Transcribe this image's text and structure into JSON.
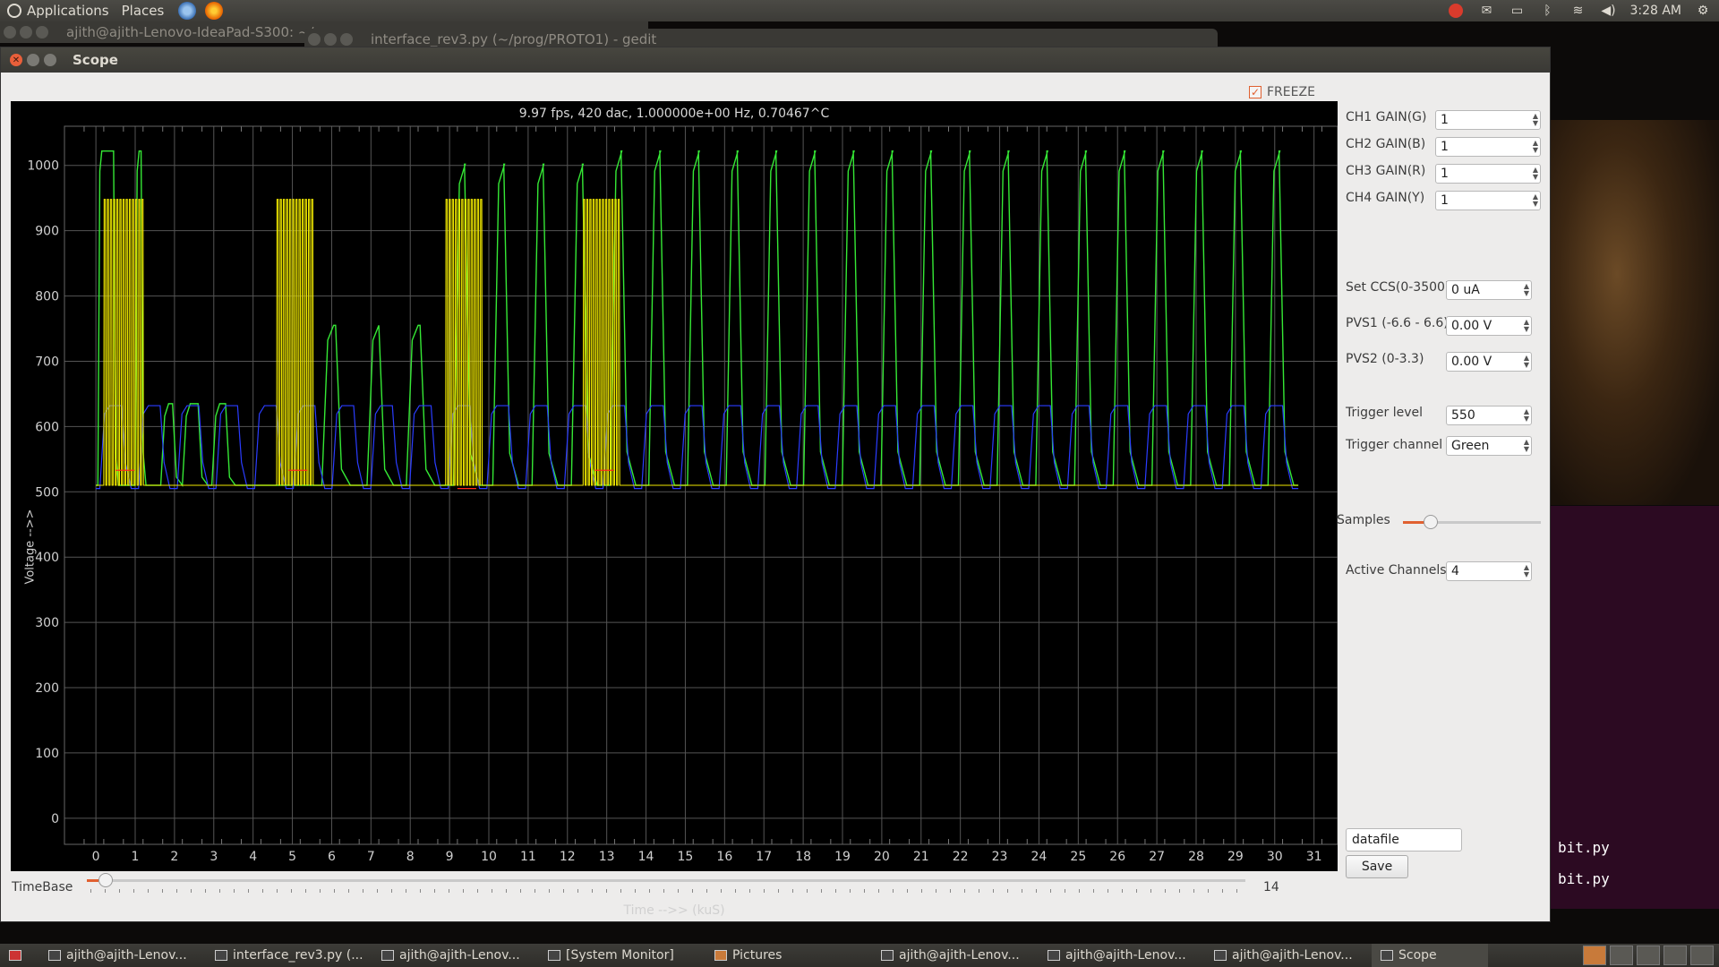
{
  "topbar": {
    "menus": [
      "Applications",
      "Places"
    ],
    "clock": "3:28 AM"
  },
  "background_windows": {
    "terminal_title": "ajith@ajith-Lenovo-IdeaPad-S300: ~/",
    "gedit_title": "interface_rev3.py (~/prog/PROTO1) - gedit",
    "terminal_lines": [
      "bit.py",
      "bit.py"
    ]
  },
  "window": {
    "title": "Scope",
    "freeze_label": "FREEZE",
    "freeze_checked": true
  },
  "plot": {
    "header": "9.97 fps, 420 dac, 1.000000e+00 Hz, 0.70467^C",
    "ylabel": "Voltage -->>",
    "xlabel": "Time -->> (kuS)",
    "yticks": [
      "1000",
      "900",
      "800",
      "700",
      "600",
      "500",
      "400",
      "300",
      "200",
      "100",
      "0"
    ],
    "xticks": [
      "0",
      "1",
      "2",
      "3",
      "4",
      "5",
      "6",
      "7",
      "8",
      "9",
      "10",
      "11",
      "12",
      "13",
      "14",
      "15",
      "16",
      "17",
      "18",
      "19",
      "20",
      "21",
      "22",
      "23",
      "24",
      "25",
      "26",
      "27",
      "28",
      "29",
      "30",
      "31"
    ]
  },
  "chart_data": {
    "type": "line",
    "title": "9.97 fps, 420 dac, 1.000000e+00 Hz, 0.70467^C",
    "xlabel": "Time -->> (kuS)",
    "ylabel": "Voltage -->>",
    "xlim": [
      -0.8,
      31.6
    ],
    "ylim": [
      -40,
      1060
    ],
    "grid": true,
    "series": [
      {
        "name": "Green",
        "color": "#35e835",
        "low": 510,
        "high": 1022,
        "pulses": [
          [
            0.05,
            0.45
          ],
          [
            1.0,
            1.15
          ],
          [
            1.4,
            1.7
          ],
          [
            2.2,
            2.5
          ]
        ]
      },
      {
        "name": "Blue",
        "color": "#2a3cff",
        "low": 505,
        "high": 632
      },
      {
        "name": "Yellow",
        "color": "#f0e800",
        "low": 510,
        "high": 948,
        "bursts": [
          [
            0.2,
            1.2
          ],
          [
            4.6,
            5.5
          ],
          [
            8.9,
            9.8
          ],
          [
            12.4,
            13.3
          ]
        ]
      },
      {
        "name": "Red",
        "color": "#ff2a1a",
        "low": 505,
        "high": 540
      }
    ]
  },
  "panel": {
    "gains": [
      {
        "label": "CH1 GAIN(G)",
        "value": "1"
      },
      {
        "label": "CH2 GAIN(B)",
        "value": "1"
      },
      {
        "label": "CH3 GAIN(R)",
        "value": "1"
      },
      {
        "label": "CH4 GAIN(Y)",
        "value": "1"
      }
    ],
    "ccs_label": "Set CCS(0-3500)",
    "ccs_value": "0 uA",
    "pvs1_label": "PVS1 (-6.6 - 6.6)",
    "pvs1_value": "0.00 V",
    "pvs2_label": "PVS2 (0-3.3)",
    "pvs2_value": "0.00 V",
    "trigger_level_label": "Trigger level",
    "trigger_level_value": "550",
    "trigger_channel_label": "Trigger channel",
    "trigger_channel_value": "Green",
    "samples_label": "Samples",
    "samples_level": 0.2,
    "active_channels_label": "Active Channels",
    "active_channels_value": "4",
    "datafile_value": "datafile",
    "save_label": "Save"
  },
  "timebase": {
    "label": "TimeBase",
    "value": "14",
    "level": 0.01
  },
  "taskbar": {
    "items": [
      "ajith@ajith-Lenov...",
      "interface_rev3.py (...",
      "ajith@ajith-Lenov...",
      "[System Monitor]",
      "Pictures",
      "ajith@ajith-Lenov...",
      "ajith@ajith-Lenov...",
      "ajith@ajith-Lenov...",
      "Scope"
    ]
  }
}
